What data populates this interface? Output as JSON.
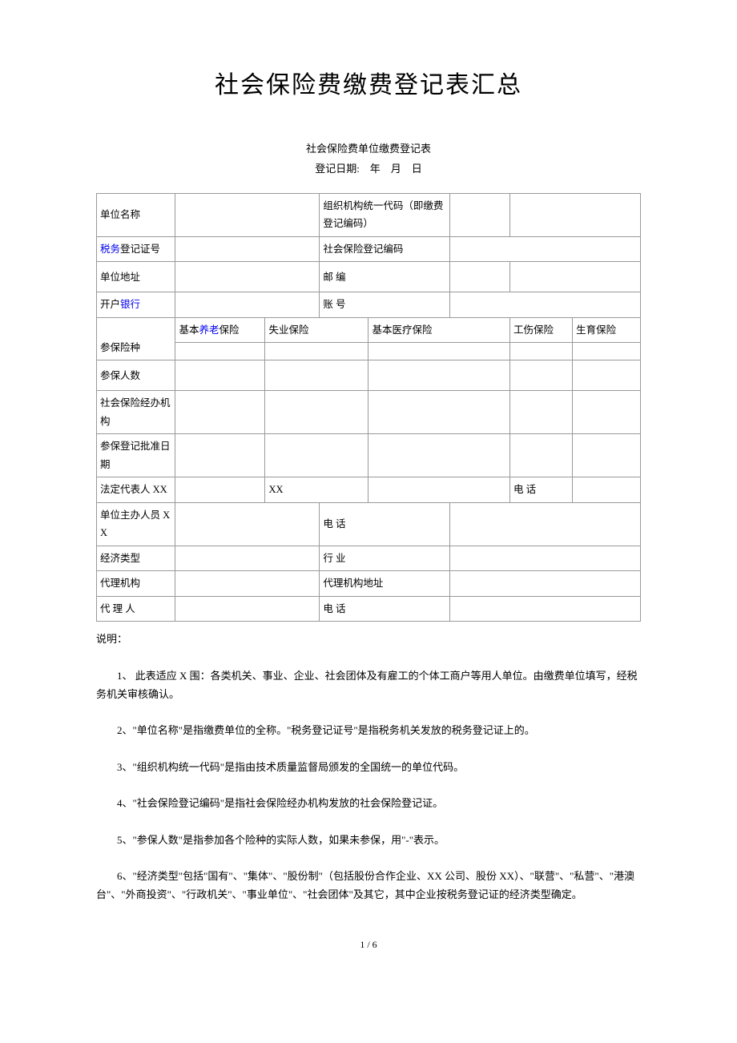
{
  "title": "社会保险费缴费登记表汇总",
  "subtitle1": "社会保险费单位缴费登记表",
  "subtitle2": "登记日期:　年　月　日",
  "labels": {
    "unit_name": "单位名称",
    "org_code": "组织机构统一代码（即缴费登记编码）",
    "tax_pre": "税务",
    "tax_suf": "登记证号",
    "social_reg": "社会保险登记编码",
    "unit_addr": "单位地址",
    "postcode": "邮 编",
    "bank_pre": "开户",
    "bank_link": "银行",
    "account": "账 号",
    "ins_pension_pre": "基本",
    "ins_pension_link": "养老",
    "ins_pension_suf": "保险",
    "ins_unemp": "失业保险",
    "ins_med": "基本医疗保险",
    "ins_injury": "工伤保险",
    "ins_birth": "生育保险",
    "ins_type": "参保险种",
    "ins_count": "参保人数",
    "agency": "社会保险经办机构",
    "approve_date": "参保登记批准日期",
    "legal_rep": "法定代表人 XX",
    "xx": "XX",
    "tel": "电 话",
    "contact": "单位主办人员 XX",
    "econ_type": "经济类型",
    "industry": "行 业",
    "proxy_org": "代理机构",
    "proxy_addr": "代理机构地址",
    "proxy_person": "代 理 人"
  },
  "notes": {
    "head": "说明：",
    "n1": "1、 此表适应 X 围：各类机关、事业、企业、社会团体及有雇工的个体工商户等用人单位。由缴费单位填写，经税务机关审核确认。",
    "n2": "2、\"单位名称\"是指缴费单位的全称。\"税务登记证号\"是指税务机关发放的税务登记证上的。",
    "n3": "3、\"组织机构统一代码\"是指由技术质量监督局颁发的全国统一的单位代码。",
    "n4": "4、\"社会保险登记编码\"是指社会保险经办机构发放的社会保险登记证。",
    "n5": "5、\"参保人数\"是指参加各个险种的实际人数，如果未参保，用\"-\"表示。",
    "n6": "6、\"经济类型\"包括\"国有\"、\"集体\"、\"股份制\"（包括股份合作企业、XX 公司、股份 XX）、\"联营\"、\"私营\"、\"港澳台\"、\"外商投资\"、\"行政机关\"、\"事业单位\"、\"社会团体\"及其它，其中企业按税务登记证的经济类型确定。"
  },
  "page": "1 / 6"
}
